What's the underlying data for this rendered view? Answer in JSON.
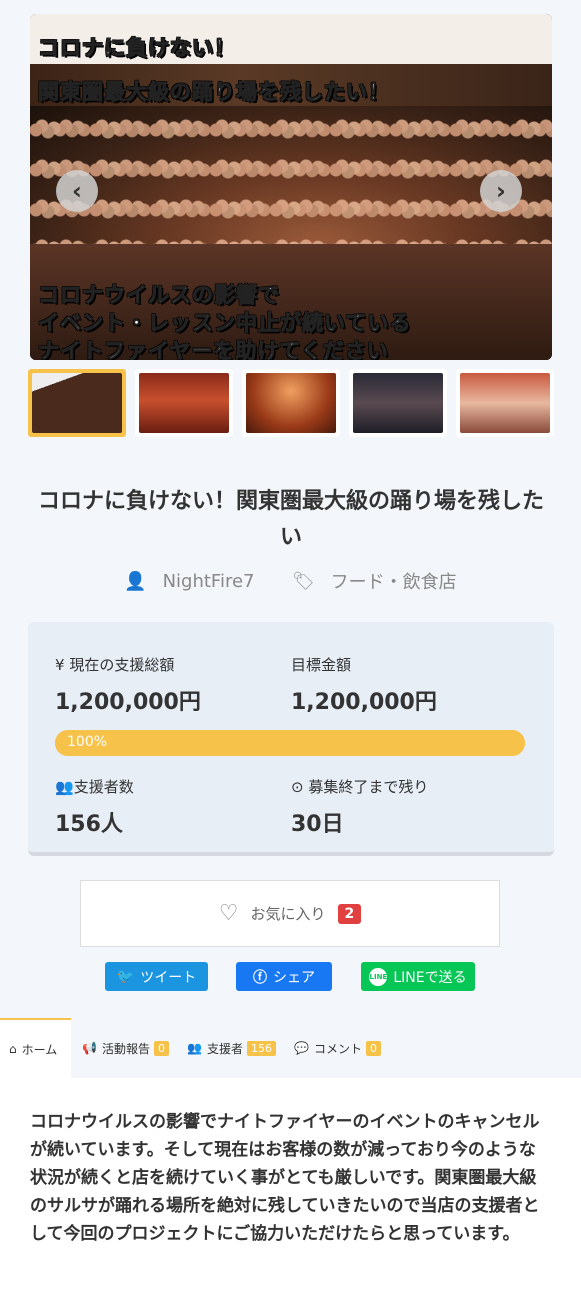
{
  "hero": {
    "caption_top_1": "コロナに負けない！",
    "caption_top_2": "関東圏最大級の踊り場を残したい！",
    "caption_bottom_1": "コロナウイルスの影響で",
    "caption_bottom_2": "イベント・レッスン中止が続いている",
    "caption_bottom_3": "ナイトファイヤーを助けてください",
    "prev_icon": "chevron-left-icon",
    "next_icon": "chevron-right-icon",
    "thumbnail_count": 5,
    "active_thumbnail": 1
  },
  "project": {
    "title": "コロナに負けない！関東圏最大級の踊り場を残したい",
    "owner": "NightFire7",
    "category": "フード・飲食店"
  },
  "stats": {
    "current_label": "現在の支援総額",
    "current_value": "1,200,000円",
    "goal_label": "目標金額",
    "goal_value": "1,200,000円",
    "progress_text": "100%",
    "progress_fraction": 1.0,
    "supporters_label": "支援者数",
    "supporters_value": "156人",
    "remaining_label": "募集終了まで残り",
    "remaining_value": "30日"
  },
  "favorite": {
    "label": "お気に入り",
    "count": "2"
  },
  "share": {
    "tweet": "ツイート",
    "facebook": "シェア",
    "line": "LINEで送る"
  },
  "tabs": [
    {
      "label": "ホーム"
    },
    {
      "label": "活動報告",
      "count": "0"
    },
    {
      "label": "支援者",
      "count": "156"
    },
    {
      "label": "コメント",
      "count": "0"
    }
  ],
  "description": "コロナウイルスの影響でナイトファイヤーのイベントのキャンセルが続いています。そして現在はお客様の数が減っており今のような状況が続くと店を続けていく事がとても厳しいです。関東圏最大級のサルサが踊れる場所を絶対に残していきたいので当店の支援者として今回のプロジェクトにご協力いただけたらと思っています。",
  "colors": {
    "accent": "#f6c24a",
    "badge": "#e04040",
    "twitter": "#1b95e0",
    "facebook": "#1877f2",
    "line": "#06c755"
  }
}
